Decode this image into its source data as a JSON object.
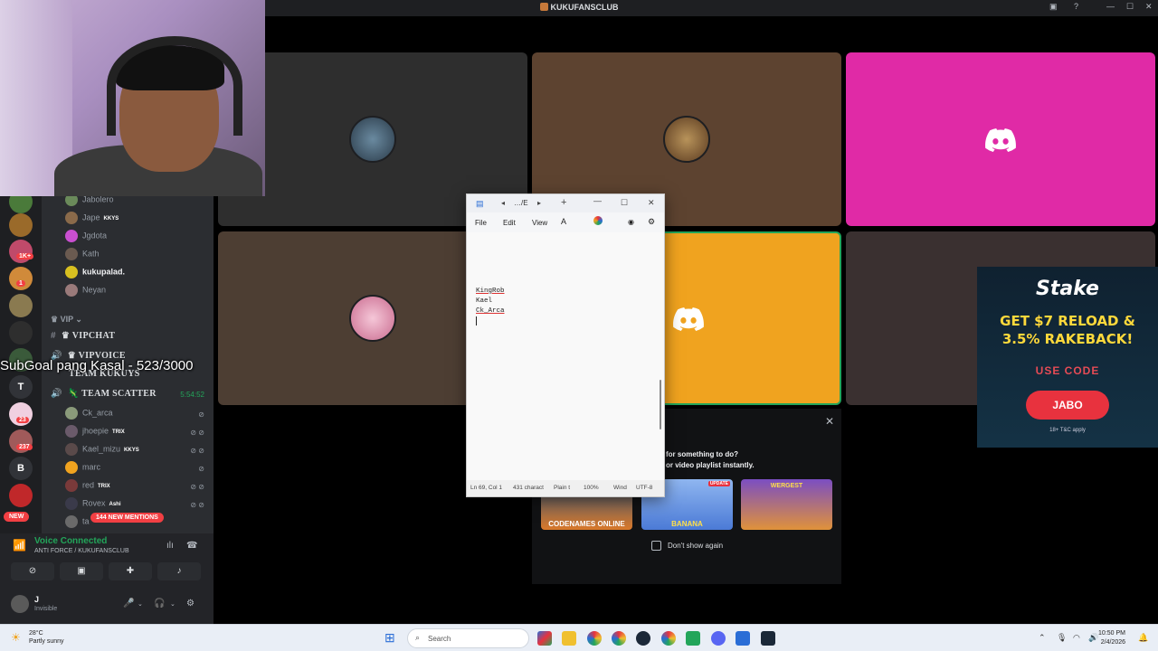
{
  "titlebar": {
    "app_name": "KUKUFANSCLUB"
  },
  "overlay": {
    "subgoal": "SubGoal pang Kasal - 523/3000"
  },
  "servers": {
    "badges": [
      "1K+",
      "1",
      "23",
      "237"
    ],
    "letters": [
      "T",
      "B"
    ],
    "new_label": "NEW"
  },
  "members_top": [
    {
      "name": "Jabolero",
      "tag": ""
    },
    {
      "name": "Jape",
      "tag": "KKYS"
    },
    {
      "name": "Jgdota",
      "tag": ""
    },
    {
      "name": "Kath",
      "tag": ""
    },
    {
      "name": "kukupalad.",
      "tag": ""
    },
    {
      "name": "Neyan",
      "tag": ""
    }
  ],
  "categories": {
    "vip": "VIP"
  },
  "channels": {
    "vipchat": "VIPCHAT",
    "vipvoice": "VIPVOICE",
    "team_kukuys": "TEAM KUKUYS",
    "team_scatter": "TEAM SCATTER",
    "team_scatter_timer": "5:54:52"
  },
  "members_voice": [
    {
      "name": "Ck_arca",
      "tag": ""
    },
    {
      "name": "jhoepie",
      "tag": "TRIX"
    },
    {
      "name": "Kael_mizu",
      "tag": "KKYS"
    },
    {
      "name": "marc",
      "tag": ""
    },
    {
      "name": "red",
      "tag": "TRIX"
    },
    {
      "name": "Rovex",
      "tag": "Ashi"
    },
    {
      "name": "ta",
      "tag": ""
    }
  ],
  "mentions_label": "144 NEW MENTIONS",
  "voice_panel": {
    "status": "Voice Connected",
    "location": "ANTI FORCE / KUKUFANSCLUB",
    "username": "J",
    "user_status": "Invisible"
  },
  "notepad": {
    "tab_label": "…/E",
    "menu": {
      "file": "File",
      "edit": "Edit",
      "view": "View"
    },
    "lines": [
      "KingRob",
      "Kael",
      "Ck_Arca"
    ],
    "status": {
      "position": "Ln 69, Col 1",
      "chars": "431 charact",
      "format": "Plain t",
      "zoom": "100%",
      "eol": "Wind",
      "encoding": "UTF-8"
    }
  },
  "activity_popup": {
    "title_line1": "for something to do?",
    "title_line2": "or video playlist instantly.",
    "games": [
      {
        "name": "CODENAMES ONLINE"
      },
      {
        "name": "BANANA"
      },
      {
        "name": "WERGEST"
      }
    ],
    "update_badge": "UPDATE",
    "dont_show": "Don't show again"
  },
  "ad": {
    "brand": "Stake",
    "headline_1": "GET $7 RELOAD &",
    "headline_2": "3.5% RAKEBACK!",
    "use_code": "USE CODE",
    "code": "JABO",
    "terms": "18+ T&C apply"
  },
  "taskbar": {
    "temp": "28°C",
    "weather": "Partly sunny",
    "search_placeholder": "Search",
    "time": "10:50 PM",
    "date": "2/4/2026"
  },
  "colors": {
    "discord_blurple": "#5865f2",
    "pink_tile": "#e02aa6",
    "orange_tile": "#f0a31f",
    "brown_tile": "#5d4330",
    "dark_tile": "#2e2e2e",
    "voice_green": "#23a55a",
    "mention_red": "#f23f43"
  }
}
